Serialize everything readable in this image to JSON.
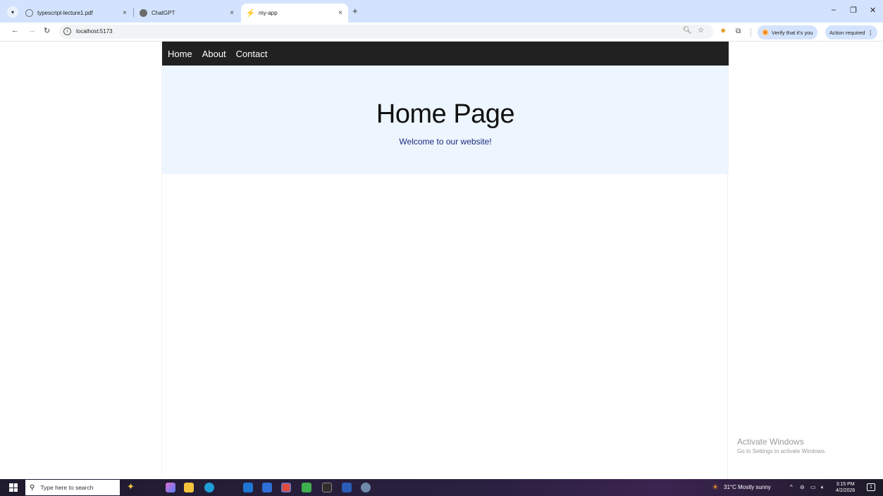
{
  "browser": {
    "tabs": [
      {
        "title": "typescript-lecture1.pdf",
        "active": false
      },
      {
        "title": "ChatGPT",
        "active": false
      },
      {
        "title": "my-app",
        "active": true
      }
    ],
    "new_tab_label": "+",
    "close_glyph": "×",
    "url": "localhost:5173",
    "verify_label": "Verify that it's you",
    "action_label": "Action required",
    "window_controls": {
      "minimize": "–",
      "restore": "❐",
      "close": "✕"
    }
  },
  "app": {
    "nav": [
      {
        "label": "Home"
      },
      {
        "label": "About"
      },
      {
        "label": "Contact"
      }
    ],
    "hero": {
      "title": "Home Page",
      "subtitle": "Welcome to our website!"
    }
  },
  "watermark": {
    "line1": "Activate Windows",
    "line2": "Go to Settings to activate Windows."
  },
  "taskbar": {
    "search_placeholder": "Type here to search",
    "weather": "31°C  Mostly sunny",
    "time": "3:15 PM",
    "date": "4/2/2026"
  },
  "colors": {
    "tabstrip": "#d3e3fd",
    "nav_bg": "#212121",
    "hero_bg": "#edf5ff",
    "subtitle": "#1b2a7a"
  }
}
